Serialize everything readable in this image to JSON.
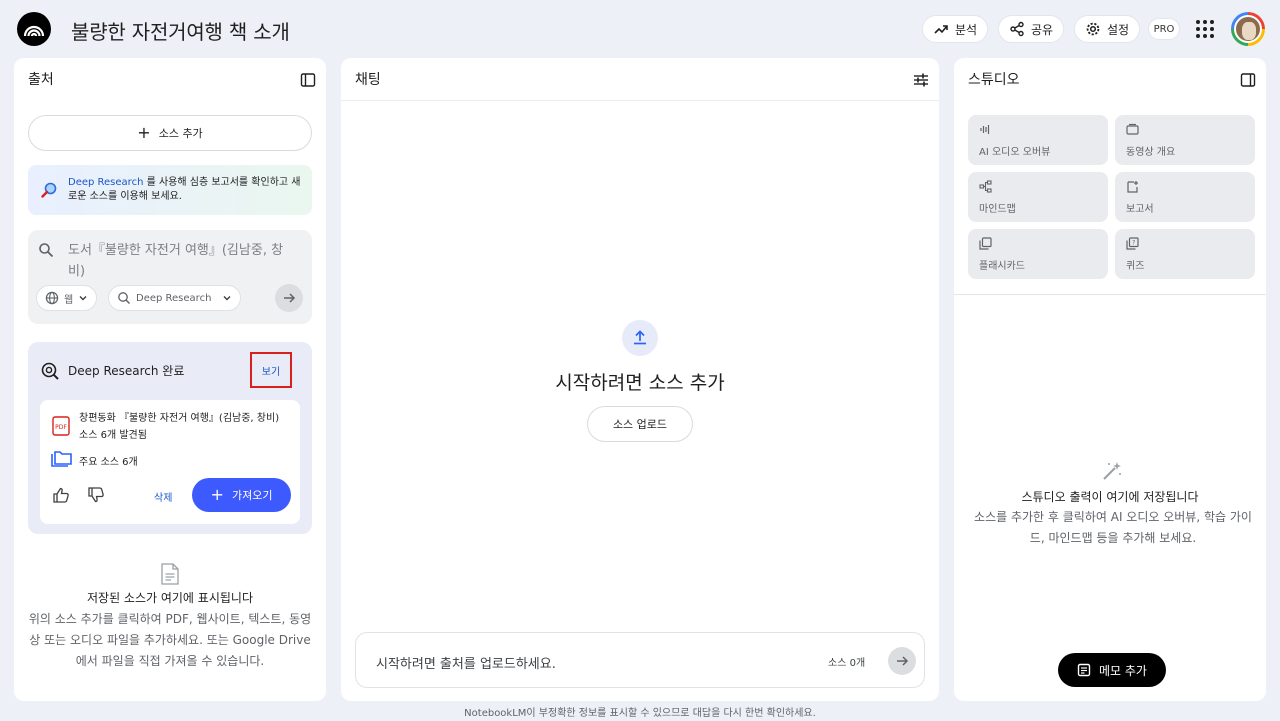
{
  "header": {
    "title": "불량한 자전거여행 책 소개",
    "analytics_label": "분석",
    "share_label": "공유",
    "settings_label": "설정",
    "pro_label": "PRO"
  },
  "sources": {
    "title": "출처",
    "add_source_label": "소스 추가",
    "banner": {
      "link_text": "Deep Research",
      "text": " 를 사용해 심층 보고서를 확인하고 새로운 소스를 이용해 보세요."
    },
    "search": {
      "placeholder": "도서『불량한 자전거 여행』(김남중, 창비)",
      "web_chip": "웹",
      "research_chip": "Deep Research"
    },
    "deep_research": {
      "title": "Deep Research 완료",
      "view_label": "보기",
      "doc_title": "창편동화 『불량한 자전거 여행』(김남중, 창비)",
      "doc_sub": "소스 6개 발견됨",
      "main_sources": "주요 소스 6개",
      "delete_label": "삭제",
      "import_label": "가져오기"
    },
    "empty": {
      "title": "저장된 소스가 여기에 표시됩니다",
      "desc": "위의 소스 추가를 클릭하여 PDF, 웹사이트, 텍스트, 동영상 또는 오디오 파일을 추가하세요. 또는 Google Drive에서 파일을 직접 가져올 수 있습니다."
    }
  },
  "chat": {
    "title": "채팅",
    "start_title": "시작하려면 소스 추가",
    "upload_label": "소스 업로드",
    "input_placeholder": "시작하려면 출처를 업로드하세요.",
    "source_count": "소스 0개"
  },
  "studio": {
    "title": "스튜디오",
    "tiles": [
      {
        "label": "AI 오디오 오버뷰",
        "icon": "audio-waveform-icon"
      },
      {
        "label": "동영상 개요",
        "icon": "video-overview-icon"
      },
      {
        "label": "마인드맵",
        "icon": "mindmap-icon"
      },
      {
        "label": "보고서",
        "icon": "report-icon"
      },
      {
        "label": "플래시카드",
        "icon": "flashcard-icon"
      },
      {
        "label": "퀴즈",
        "icon": "quiz-icon"
      }
    ],
    "output_title": "스튜디오 출력이 여기에 저장됩니다",
    "output_desc": "소스를 추가한 후 클릭하여 AI 오디오 오버뷰, 학습 가이드, 마인드맵 등을 추가해 보세요.",
    "memo_label": "메모 추가"
  },
  "footer": {
    "note": "NotebookLM이 부정확한 정보를 표시할 수 있으므로 대답을 다시 한번 확인하세요."
  },
  "colors": {
    "background": "#eef0f8",
    "accent_blue": "#3d5afe",
    "link_blue": "#1a56c9",
    "highlight_red": "#d9211b"
  }
}
